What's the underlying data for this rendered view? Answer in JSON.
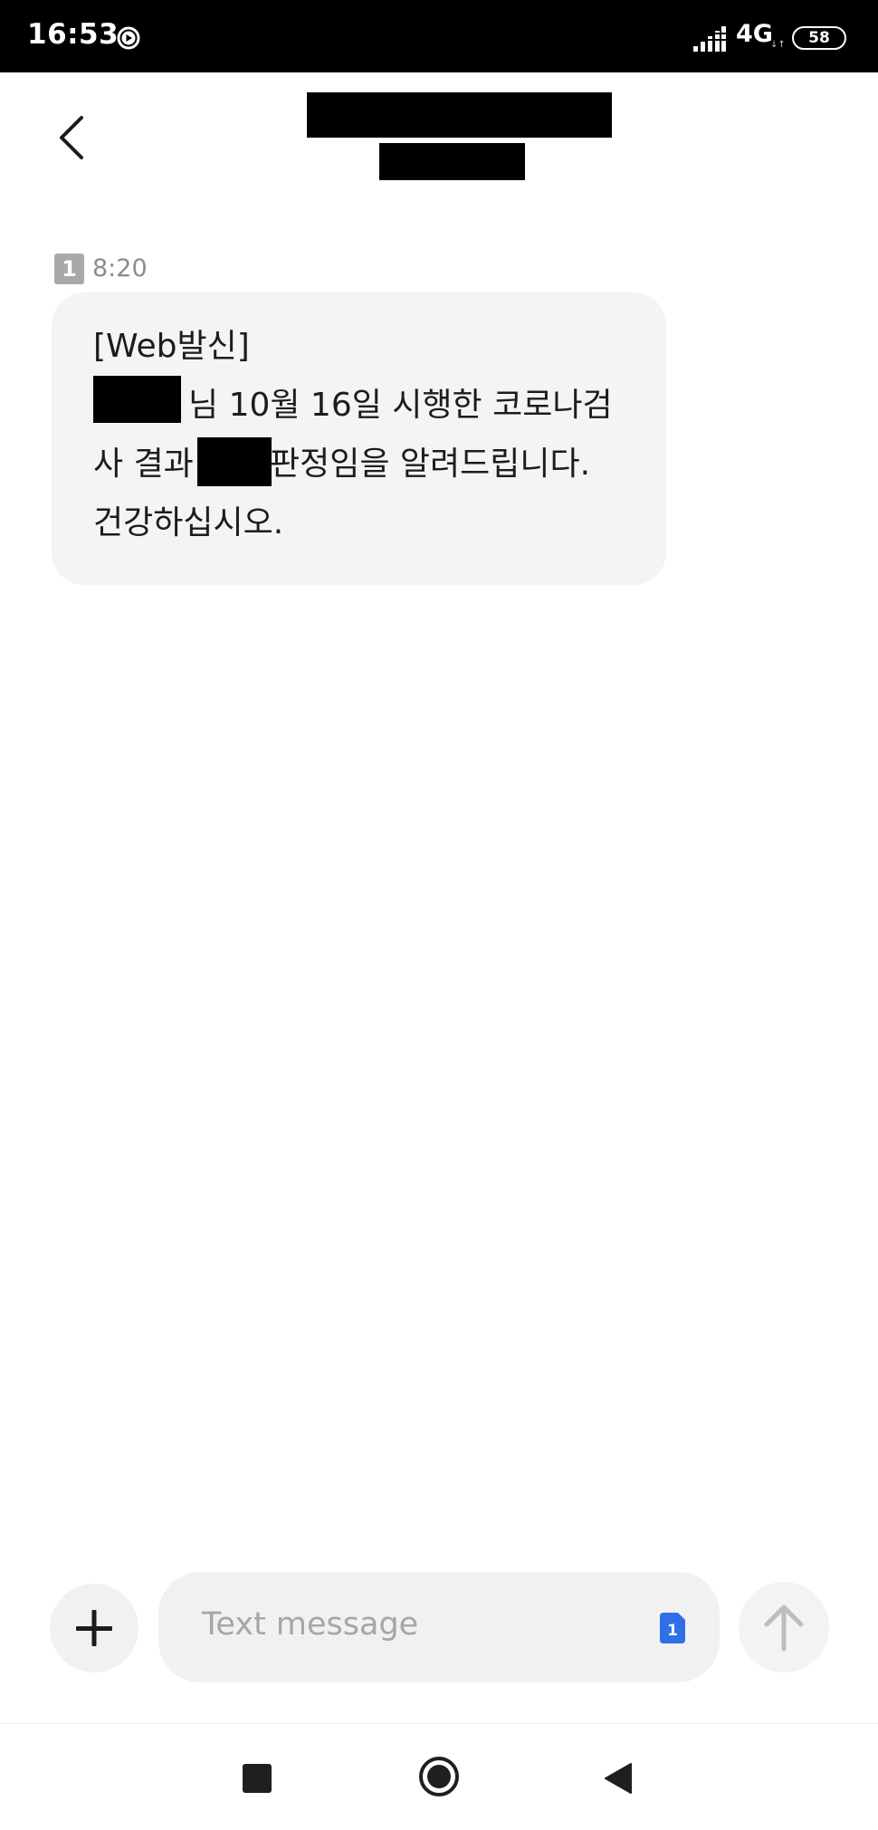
{
  "status_bar": {
    "time": "16:53",
    "network": "4G",
    "battery": "58",
    "icons": [
      "play-circle-icon",
      "signal-icon",
      "battery-icon"
    ]
  },
  "message": {
    "sim_slot": "1",
    "time": "8:20",
    "lines": {
      "line1": "[Web발신]",
      "line2": "님 10월 16일 시행한 코로나검",
      "line3_a": "사 결과",
      "line3_b": "판정임을 알려드립니다.",
      "line4": "건강하십시오."
    }
  },
  "composer": {
    "placeholder": "Text message",
    "sim_chip": "1",
    "icons": [
      "plus-icon",
      "sim-card-icon",
      "arrow-up-icon"
    ]
  },
  "nav_bar": {
    "icons": [
      "square-icon",
      "circle-icon",
      "triangle-back-icon"
    ]
  },
  "colors": {
    "bubble": "#f4f4f4",
    "sim_chip": "#2f6fe8",
    "status_bar": "#000000"
  }
}
